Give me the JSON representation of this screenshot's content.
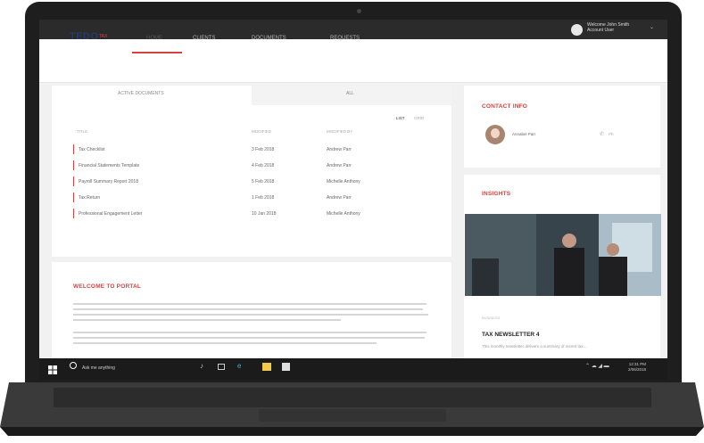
{
  "os": {
    "user_name": "Welcome John Smith",
    "user_role": "Account User",
    "caret": "⌄"
  },
  "app": {
    "logo": "TEDO",
    "logo_mark": "TAX",
    "tabs": [
      {
        "label": "HOME",
        "active": true
      },
      {
        "label": "CLIENTS",
        "active": false
      },
      {
        "label": "DOCUMENTS",
        "active": false
      },
      {
        "label": "REQUESTS",
        "active": false
      }
    ]
  },
  "documents": {
    "filters": [
      "ACTIVE DOCUMENTS",
      "ALL"
    ],
    "view_toggle": [
      "LIST",
      "GRID"
    ],
    "columns": [
      "TITLE",
      "MODIFIED",
      "MODIFIED BY"
    ],
    "rows": [
      [
        "Tax Checklist",
        "3 Feb 2018",
        "Andrew Parr"
      ],
      [
        "Financial Statements Template",
        "4 Feb 2018",
        "Andrew Parr"
      ],
      [
        "Payroll Summary Report 2018",
        "5 Feb 2018",
        "Michelle Anthony"
      ],
      [
        "Tax Return",
        "1 Feb 2018",
        "Andrew Parr"
      ],
      [
        "Professional Engagement Letter",
        "10 Jan 2018",
        "Michelle Anthony"
      ]
    ]
  },
  "welcome": {
    "title": "WELCOME TO PORTAL"
  },
  "contact": {
    "title": "CONTACT INFO",
    "name": "Annabel Parr",
    "phone_icon": "phone-icon",
    "phone_short": "Ph"
  },
  "insights": {
    "title": "INSIGHTS",
    "category": "BUSINESS",
    "article_title": "TAX NEWSLETTER 4",
    "article_summary": "This monthly newsletter delivers a summary of recent tax..."
  },
  "taskbar": {
    "search_placeholder": "Ask me anything",
    "time": "12:31 PM",
    "date": "2/06/2018"
  },
  "colors": {
    "accent": "#d94040",
    "brand": "#243a6b",
    "os_bar": "#2b2b2b",
    "taskbar": "#1b1b1b"
  }
}
